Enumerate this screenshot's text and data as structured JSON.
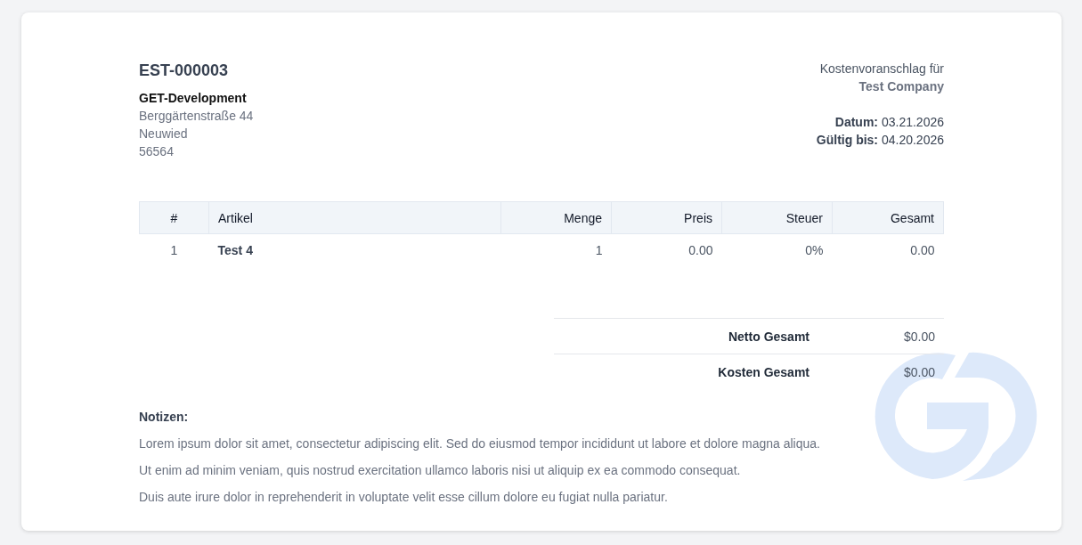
{
  "estimate": {
    "number": "EST-000003",
    "company": {
      "name": "GET-Development",
      "street": "Berggärtenstraße 44",
      "city": "Neuwied",
      "zip": "56564"
    },
    "recipient": {
      "label": "Kostenvoranschlag für",
      "name": "Test Company"
    },
    "dates": [
      {
        "label": "Datum:",
        "value": "03.21.2026"
      },
      {
        "label": "Gültig bis:",
        "value": "04.20.2026"
      }
    ]
  },
  "table": {
    "columns": [
      "#",
      "Artikel",
      "Menge",
      "Preis",
      "Steuer",
      "Gesamt"
    ],
    "rows": [
      [
        "1",
        "Test 4",
        "1",
        "0.00",
        "0%",
        "0.00"
      ]
    ]
  },
  "totals": [
    {
      "label": "Netto Gesamt",
      "value": "$0.00"
    },
    {
      "label": "Kosten Gesamt",
      "value": "$0.00"
    }
  ],
  "notes": {
    "title": "Notizen:",
    "paragraphs": [
      "Lorem ipsum dolor sit amet, consectetur adipiscing elit. Sed do eiusmod tempor incididunt ut labore et dolore magna aliqua.",
      "Ut enim ad minim veniam, quis nostrud exercitation ullamco laboris nisi ut aliquip ex ea commodo consequat.",
      "Duis aute irure dolor in reprehenderit in voluptate velit esse cillum dolore eu fugiat nulla pariatur."
    ]
  }
}
